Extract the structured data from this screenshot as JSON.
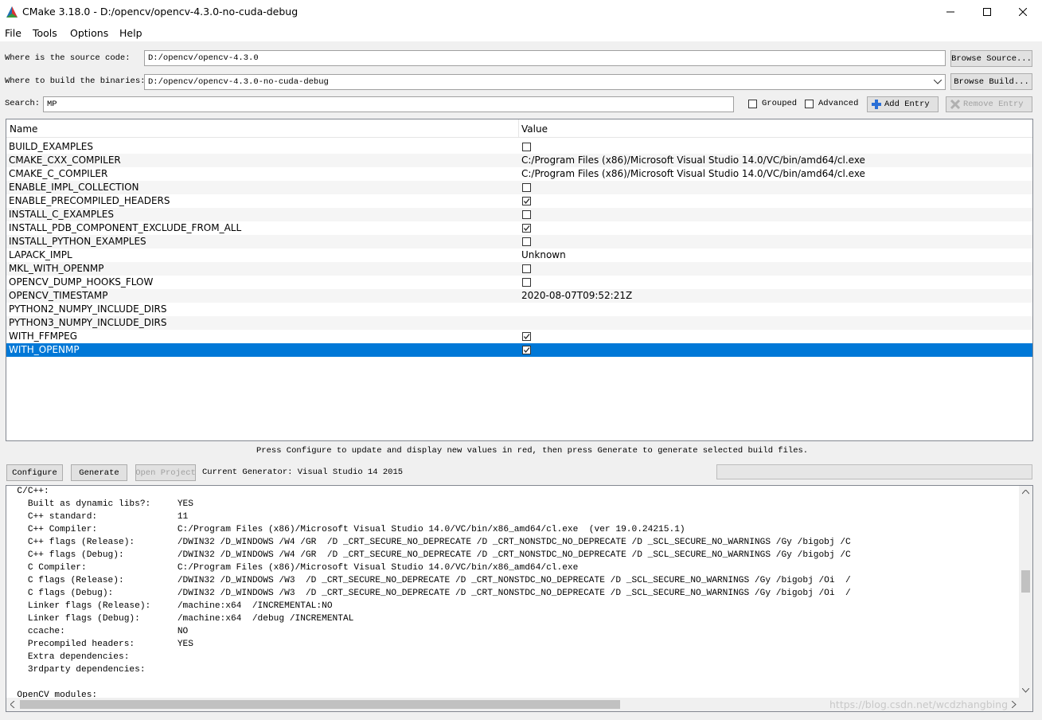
{
  "window": {
    "title": "CMake 3.18.0 - D:/opencv/opencv-4.3.0-no-cuda-debug"
  },
  "menu": [
    "File",
    "Tools",
    "Options",
    "Help"
  ],
  "source": {
    "label": "Where is the source code:",
    "value": "D:/opencv/opencv-4.3.0",
    "button": "Browse Source..."
  },
  "build": {
    "label": "Where to build the binaries:",
    "value": "D:/opencv/opencv-4.3.0-no-cuda-debug",
    "button": "Browse Build..."
  },
  "search": {
    "label": "Search:",
    "value": "MP"
  },
  "options": {
    "grouped": "Grouped",
    "advanced": "Advanced",
    "add_entry": "Add Entry",
    "remove_entry": "Remove Entry"
  },
  "table": {
    "headers": {
      "name": "Name",
      "value": "Value"
    },
    "rows": [
      {
        "name": "BUILD_EXAMPLES",
        "type": "bool",
        "checked": false,
        "value": ""
      },
      {
        "name": "CMAKE_CXX_COMPILER",
        "type": "text",
        "checked": false,
        "value": "C:/Program Files (x86)/Microsoft Visual Studio 14.0/VC/bin/amd64/cl.exe"
      },
      {
        "name": "CMAKE_C_COMPILER",
        "type": "text",
        "checked": false,
        "value": "C:/Program Files (x86)/Microsoft Visual Studio 14.0/VC/bin/amd64/cl.exe"
      },
      {
        "name": "ENABLE_IMPL_COLLECTION",
        "type": "bool",
        "checked": false,
        "value": ""
      },
      {
        "name": "ENABLE_PRECOMPILED_HEADERS",
        "type": "bool",
        "checked": true,
        "value": ""
      },
      {
        "name": "INSTALL_C_EXAMPLES",
        "type": "bool",
        "checked": false,
        "value": ""
      },
      {
        "name": "INSTALL_PDB_COMPONENT_EXCLUDE_FROM_ALL",
        "type": "bool",
        "checked": true,
        "value": ""
      },
      {
        "name": "INSTALL_PYTHON_EXAMPLES",
        "type": "bool",
        "checked": false,
        "value": ""
      },
      {
        "name": "LAPACK_IMPL",
        "type": "text",
        "checked": false,
        "value": "Unknown"
      },
      {
        "name": "MKL_WITH_OPENMP",
        "type": "bool",
        "checked": false,
        "value": ""
      },
      {
        "name": "OPENCV_DUMP_HOOKS_FLOW",
        "type": "bool",
        "checked": false,
        "value": ""
      },
      {
        "name": "OPENCV_TIMESTAMP",
        "type": "text",
        "checked": false,
        "value": "2020-08-07T09:52:21Z"
      },
      {
        "name": "PYTHON2_NUMPY_INCLUDE_DIRS",
        "type": "text",
        "checked": false,
        "value": ""
      },
      {
        "name": "PYTHON3_NUMPY_INCLUDE_DIRS",
        "type": "text",
        "checked": false,
        "value": ""
      },
      {
        "name": "WITH_FFMPEG",
        "type": "bool",
        "checked": true,
        "value": ""
      },
      {
        "name": "WITH_OPENMP",
        "type": "bool",
        "checked": true,
        "value": "",
        "selected": true
      }
    ]
  },
  "hint": "Press Configure to update and display new values in red, then press Generate to generate selected build files.",
  "actions": {
    "configure": "Configure",
    "generate": "Generate",
    "open_project": "Open Project",
    "generator": "Current Generator: Visual Studio 14 2015"
  },
  "output_lines": [
    "  C/C++:",
    "    Built as dynamic libs?:     YES",
    "    C++ standard:               11",
    "    C++ Compiler:               C:/Program Files (x86)/Microsoft Visual Studio 14.0/VC/bin/x86_amd64/cl.exe  (ver 19.0.24215.1)",
    "    C++ flags (Release):        /DWIN32 /D_WINDOWS /W4 /GR  /D _CRT_SECURE_NO_DEPRECATE /D _CRT_NONSTDC_NO_DEPRECATE /D _SCL_SECURE_NO_WARNINGS /Gy /bigobj /C",
    "    C++ flags (Debug):          /DWIN32 /D_WINDOWS /W4 /GR  /D _CRT_SECURE_NO_DEPRECATE /D _CRT_NONSTDC_NO_DEPRECATE /D _SCL_SECURE_NO_WARNINGS /Gy /bigobj /C",
    "    C Compiler:                 C:/Program Files (x86)/Microsoft Visual Studio 14.0/VC/bin/x86_amd64/cl.exe",
    "    C flags (Release):          /DWIN32 /D_WINDOWS /W3  /D _CRT_SECURE_NO_DEPRECATE /D _CRT_NONSTDC_NO_DEPRECATE /D _SCL_SECURE_NO_WARNINGS /Gy /bigobj /Oi  /",
    "    C flags (Debug):            /DWIN32 /D_WINDOWS /W3  /D _CRT_SECURE_NO_DEPRECATE /D _CRT_NONSTDC_NO_DEPRECATE /D _SCL_SECURE_NO_WARNINGS /Gy /bigobj /Oi  /",
    "    Linker flags (Release):     /machine:x64  /INCREMENTAL:NO",
    "    Linker flags (Debug):       /machine:x64  /debug /INCREMENTAL",
    "    ccache:                     NO",
    "    Precompiled headers:        YES",
    "    Extra dependencies:",
    "    3rdparty dependencies:",
    "",
    "  OpenCV modules:"
  ],
  "watermark": "https://blog.csdn.net/wcdzhangbing"
}
